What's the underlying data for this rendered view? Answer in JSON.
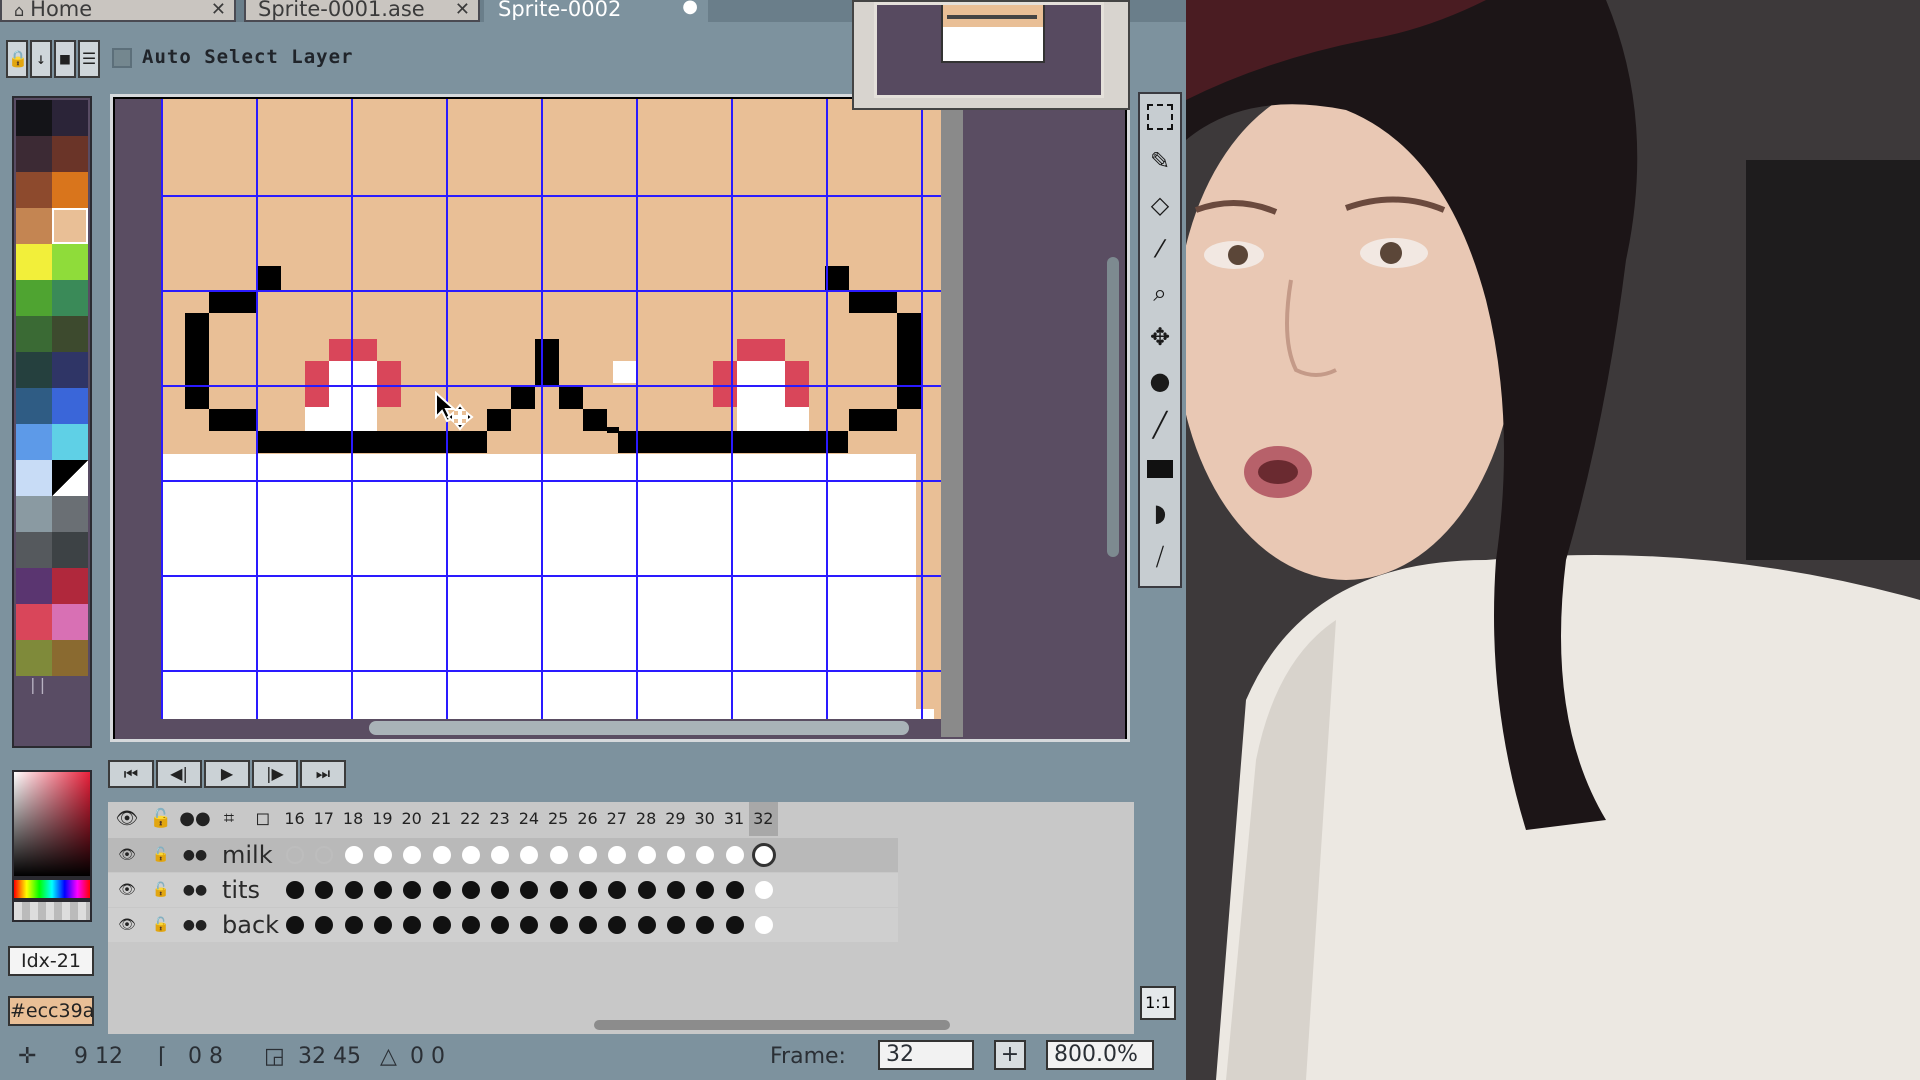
{
  "tabs": [
    {
      "label": "Home",
      "icon": "home-icon",
      "active": false,
      "closable": true
    },
    {
      "label": "Sprite-0001.ase",
      "active": false,
      "closable": true
    },
    {
      "label": "Sprite-0002",
      "active": true,
      "modified": true
    }
  ],
  "options": {
    "auto_select_label": "Auto Select Layer"
  },
  "colors": {
    "background": "#ecc39a",
    "accent_red": "#d9465a",
    "grid": "#2a1aff"
  },
  "toolbar": [
    "rect-select-icon",
    "pencil-icon",
    "eraser-icon",
    "eyedropper-icon",
    "zoom-icon",
    "move-icon",
    "paint-bucket-icon",
    "line-icon",
    "rectangle-icon",
    "contour-icon",
    "blur-icon"
  ],
  "playback": [
    "first-frame-icon",
    "previous-frame-icon",
    "play-icon",
    "next-frame-icon",
    "last-frame-icon"
  ],
  "timeline": {
    "frames": [
      "16",
      "17",
      "18",
      "19",
      "20",
      "21",
      "22",
      "23",
      "24",
      "25",
      "26",
      "27",
      "28",
      "29",
      "30",
      "31",
      "32"
    ],
    "layers": [
      {
        "name": "milk"
      },
      {
        "name": "tits"
      },
      {
        "name": "back"
      }
    ]
  },
  "color_panel": {
    "index_label": "Idx-21",
    "hex_label": "#ecc39a"
  },
  "status": {
    "position": "9 12",
    "size_origin": "0 8",
    "canvas_size": "32 45",
    "delta": "0 0",
    "frame_label": "Frame:",
    "frame_value": "32",
    "zoom_value": "800.0%",
    "ratio_label": "1:1"
  }
}
